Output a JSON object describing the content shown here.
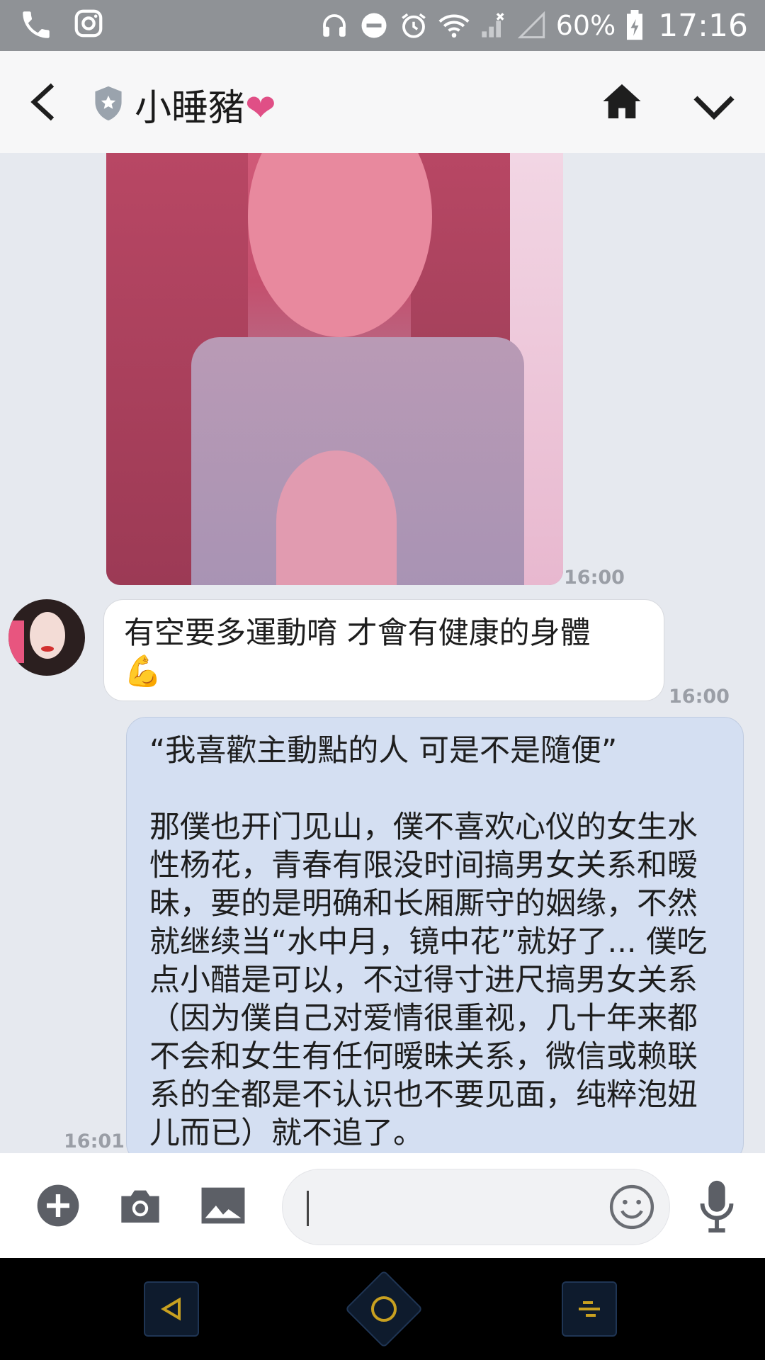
{
  "status_bar": {
    "battery": "60%",
    "time": "17:16"
  },
  "header": {
    "contact_name": "小睡豬",
    "heart": "❤"
  },
  "messages": [
    {
      "type": "image",
      "time": "16:00"
    },
    {
      "type": "incoming",
      "text": "有空要多運動唷 才會有健康的身體\n💪",
      "time": "16:00"
    },
    {
      "type": "outgoing",
      "text": "“我喜歡主動點的人 可是不是隨便”\n\n那僕也开门见山，僕不喜欢心仪的女生水性杨花，青春有限没时间搞男女关系和暧昧，要的是明确和长厢厮守的姻缘，不然就继续当“水中月，镜中花”就好了... 僕吃点小醋是可以，不过得寸进尺搞男女关系（因为僕自己对爱情很重视，几十年来都不会和女生有任何暧昧关系，微信或赖联系的全都是不认识也不要见面，纯粹泡妞儿而已）就不追了。",
      "time": "16:01"
    }
  ],
  "input_bar": {
    "placeholder": ""
  },
  "colors": {
    "header_bg": "#f7f7f8",
    "chat_bg": "#e6e9ef",
    "outgoing_bubble": "#d4dff2",
    "nav_accent": "#c8a020"
  }
}
